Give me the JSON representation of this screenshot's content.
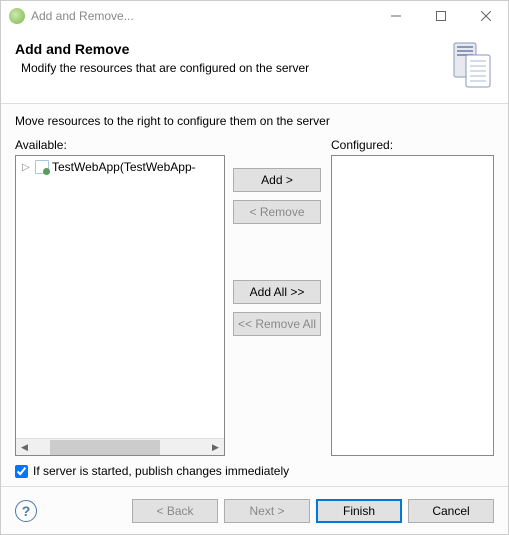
{
  "window": {
    "title": "Add and Remove..."
  },
  "banner": {
    "title": "Add and Remove",
    "subtitle": "Modify the resources that are configured on the server"
  },
  "content": {
    "instruction": "Move resources to the right to configure them on the server",
    "available_label": "Available:",
    "configured_label": "Configured:",
    "available_items": [
      {
        "label": "TestWebApp(TestWebApp-"
      }
    ],
    "buttons": {
      "add": "Add >",
      "remove": "< Remove",
      "add_all": "Add All >>",
      "remove_all": "<< Remove All"
    },
    "checkbox_label": "If server is started, publish changes immediately",
    "checkbox_checked": true
  },
  "footer": {
    "back": "< Back",
    "next": "Next >",
    "finish": "Finish",
    "cancel": "Cancel"
  }
}
